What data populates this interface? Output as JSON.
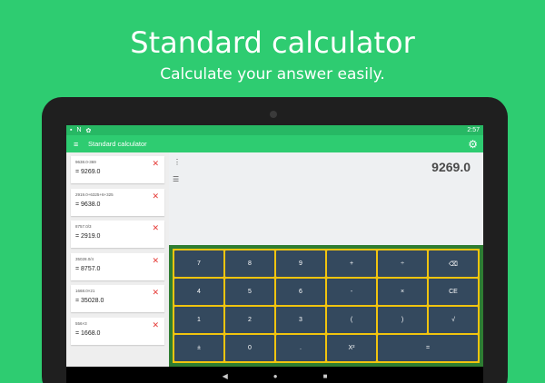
{
  "promo": {
    "title": "Standard calculator",
    "subtitle": "Calculate your answer easily."
  },
  "statusbar": {
    "left": [
      "▪",
      "N",
      "✿"
    ],
    "time": "2:57"
  },
  "appbar": {
    "title": "Standard calculator",
    "menu_icon": "≡",
    "settings_icon": "⚙"
  },
  "history": [
    {
      "expr": "9638.0-369",
      "result": "= 9269.0"
    },
    {
      "expr": "2919.0+6325+6+325",
      "result": "= 9638.0"
    },
    {
      "expr": "8757.0/3",
      "result": "= 2919.0"
    },
    {
      "expr": "35028.0/4",
      "result": "= 8757.0"
    },
    {
      "expr": "1668.0×21",
      "result": "= 35028.0"
    },
    {
      "expr": "556×3",
      "result": "= 1668.0"
    }
  ],
  "delete_icon": "✕",
  "display": {
    "value": "9269.0",
    "dots": "⋮",
    "list_icon": "☰"
  },
  "keys": [
    [
      "7",
      "8",
      "9",
      "+",
      "÷",
      "⌫"
    ],
    [
      "4",
      "5",
      "6",
      "-",
      "×",
      "CE"
    ],
    [
      "1",
      "2",
      "3",
      "(",
      ")",
      "√"
    ],
    [
      "±",
      "0",
      ".",
      "X²",
      "="
    ]
  ],
  "nav": {
    "back": "◀",
    "home": "●",
    "recents": "■"
  },
  "colors": {
    "background": "#2ecc71",
    "keypad_border": "#f1c40f",
    "key": "#34495e",
    "delete": "#e53935"
  }
}
